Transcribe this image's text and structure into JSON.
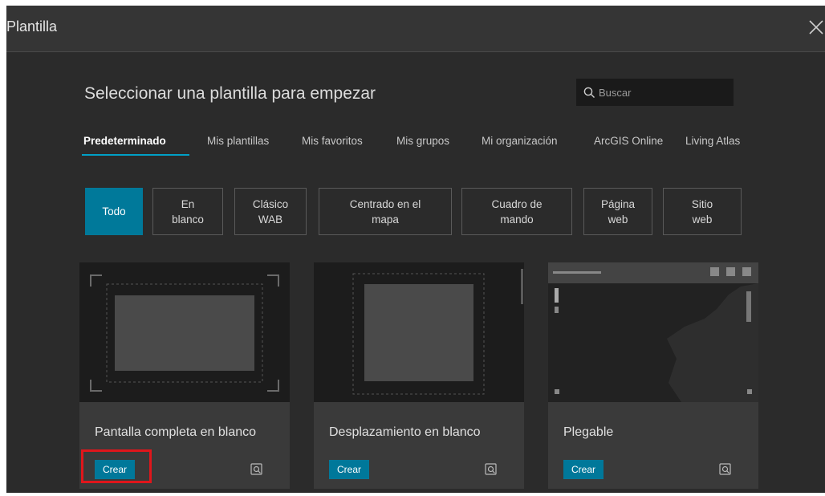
{
  "dialog": {
    "title": "Plantilla",
    "heading": "Seleccionar una plantilla para empezar",
    "search_placeholder": "Buscar"
  },
  "tabs": [
    {
      "label": "Predeterminado",
      "active": true
    },
    {
      "label": "Mis plantillas",
      "active": false
    },
    {
      "label": "Mis favoritos",
      "active": false
    },
    {
      "label": "Mis grupos",
      "active": false
    },
    {
      "label": "Mi organización",
      "active": false
    },
    {
      "label": "ArcGIS Online",
      "active": false
    },
    {
      "label": "Living Atlas",
      "active": false
    }
  ],
  "filters": [
    {
      "line1": "Todo",
      "line2": "",
      "active": true
    },
    {
      "line1": "En",
      "line2": "blanco",
      "active": false
    },
    {
      "line1": "Clásico",
      "line2": "WAB",
      "active": false
    },
    {
      "line1": "Centrado en el",
      "line2": "mapa",
      "active": false
    },
    {
      "line1": "Cuadro de",
      "line2": "mando",
      "active": false
    },
    {
      "line1": "Página",
      "line2": "web",
      "active": false
    },
    {
      "line1": "Sitio",
      "line2": "web",
      "active": false
    }
  ],
  "templates": [
    {
      "title": "Pantalla completa en blanco",
      "create_label": "Crear",
      "thumbnail": "fullscreen-blank"
    },
    {
      "title": "Desplazamiento en blanco",
      "create_label": "Crear",
      "thumbnail": "scrolling-blank"
    },
    {
      "title": "Plegable",
      "create_label": "Crear",
      "thumbnail": "foldable-map"
    }
  ],
  "colors": {
    "accent": "#00799a",
    "highlight": "#e0161b",
    "background": "#2b2b2b"
  }
}
